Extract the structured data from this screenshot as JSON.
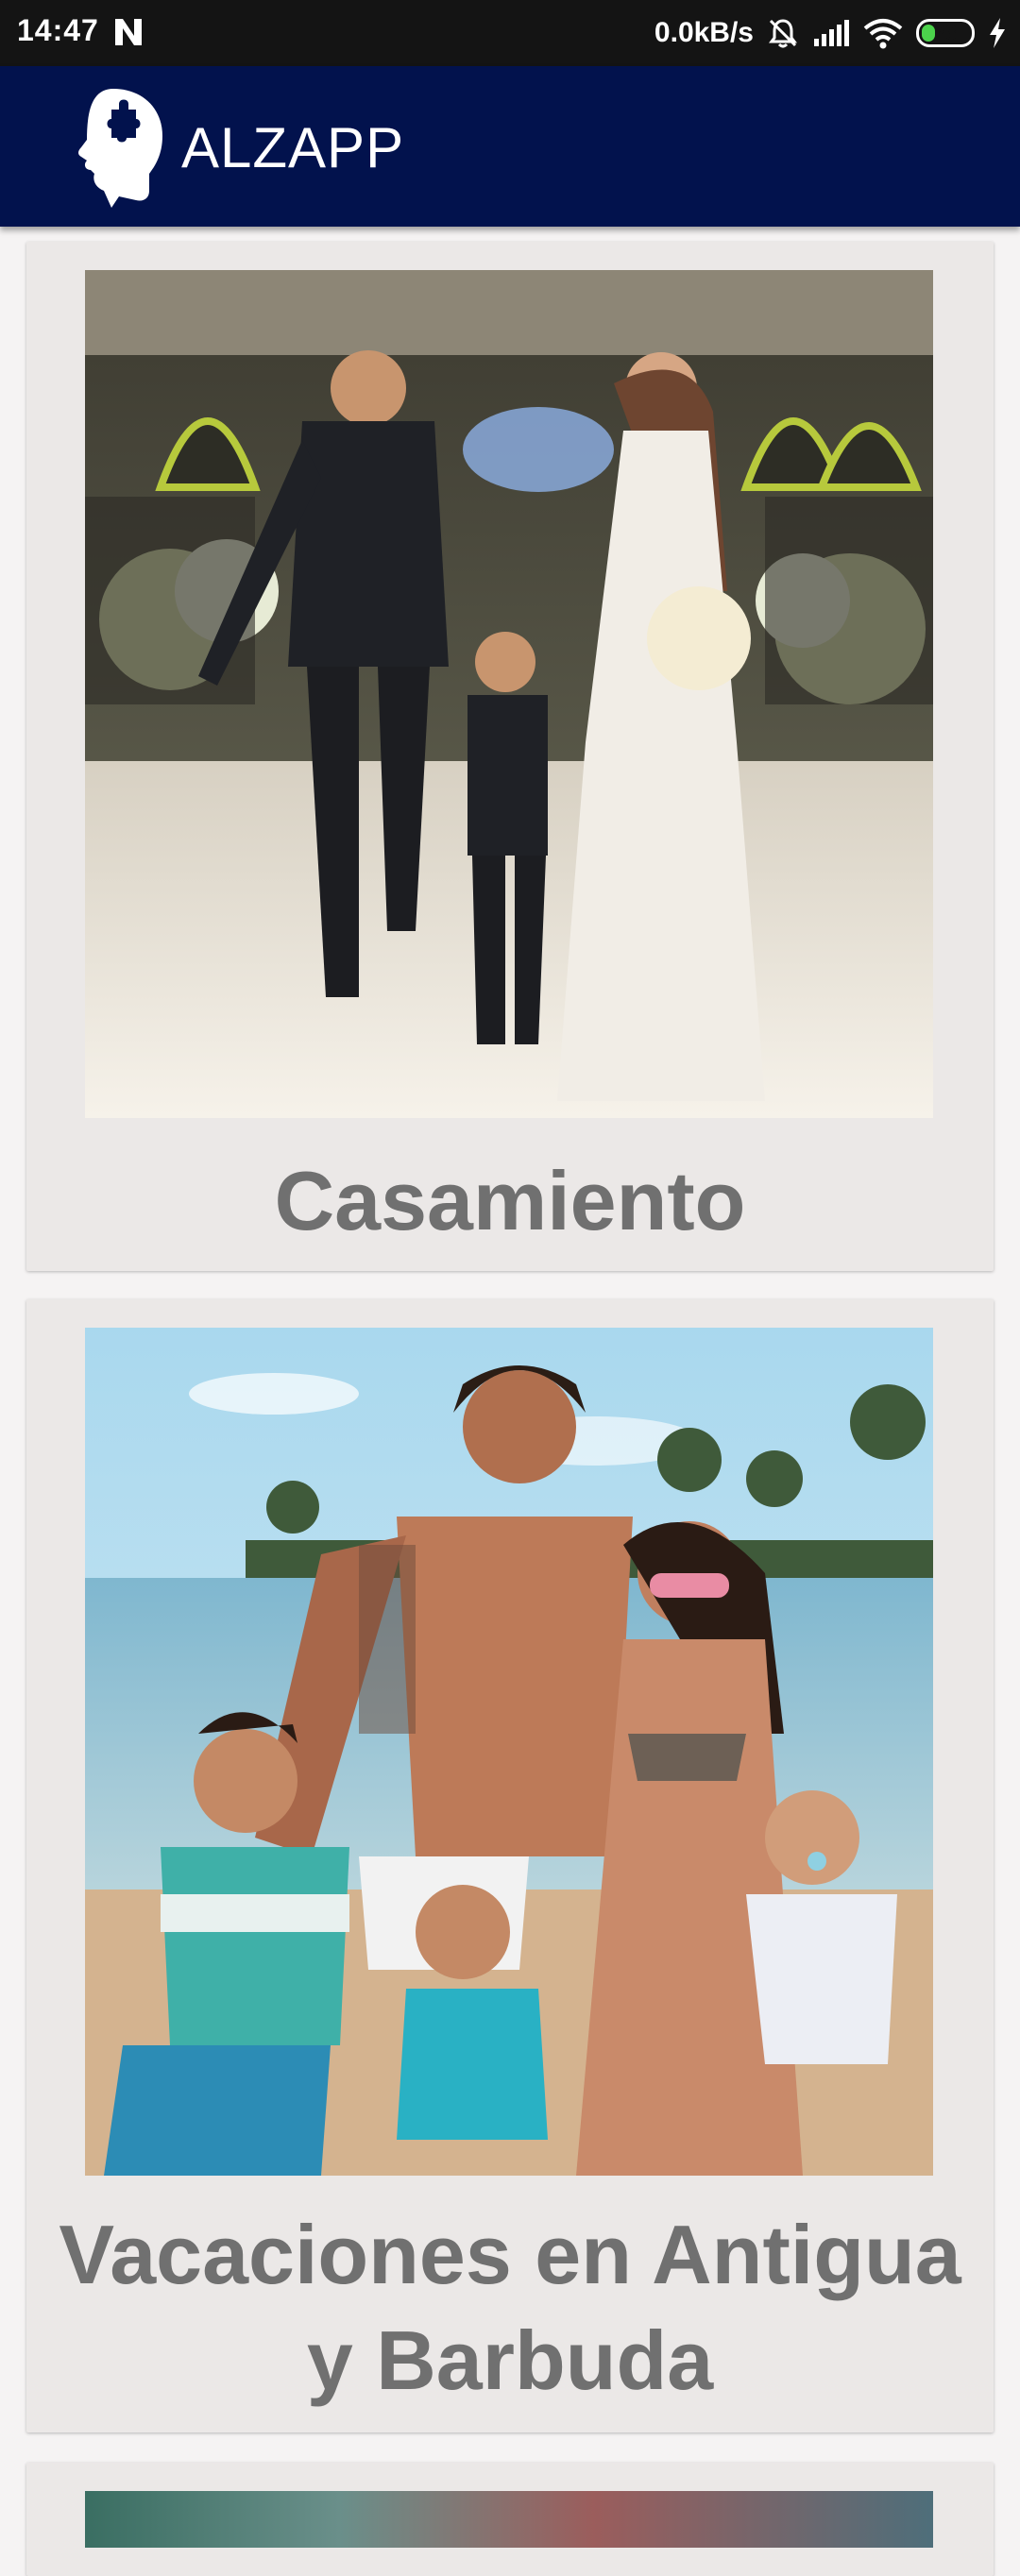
{
  "status_bar": {
    "time": "14:47",
    "speed": "0.0kB/s",
    "battery_level": "28",
    "battery_fraction": 0.28,
    "icons": [
      "notification-n-icon",
      "silent-bell-icon",
      "signal-icon",
      "wifi-icon",
      "battery-icon",
      "charging-icon"
    ]
  },
  "app_bar": {
    "title": "ALZAPP",
    "logo_icon": "head-puzzle-icon",
    "background_color": "#02124d"
  },
  "cards": [
    {
      "title": "Casamiento",
      "image": "wedding-photo"
    },
    {
      "title": "Vacaciones en Antigua y Barbuda",
      "image": "beach-family-photo"
    },
    {
      "title": "",
      "image": "partial-photo"
    }
  ]
}
